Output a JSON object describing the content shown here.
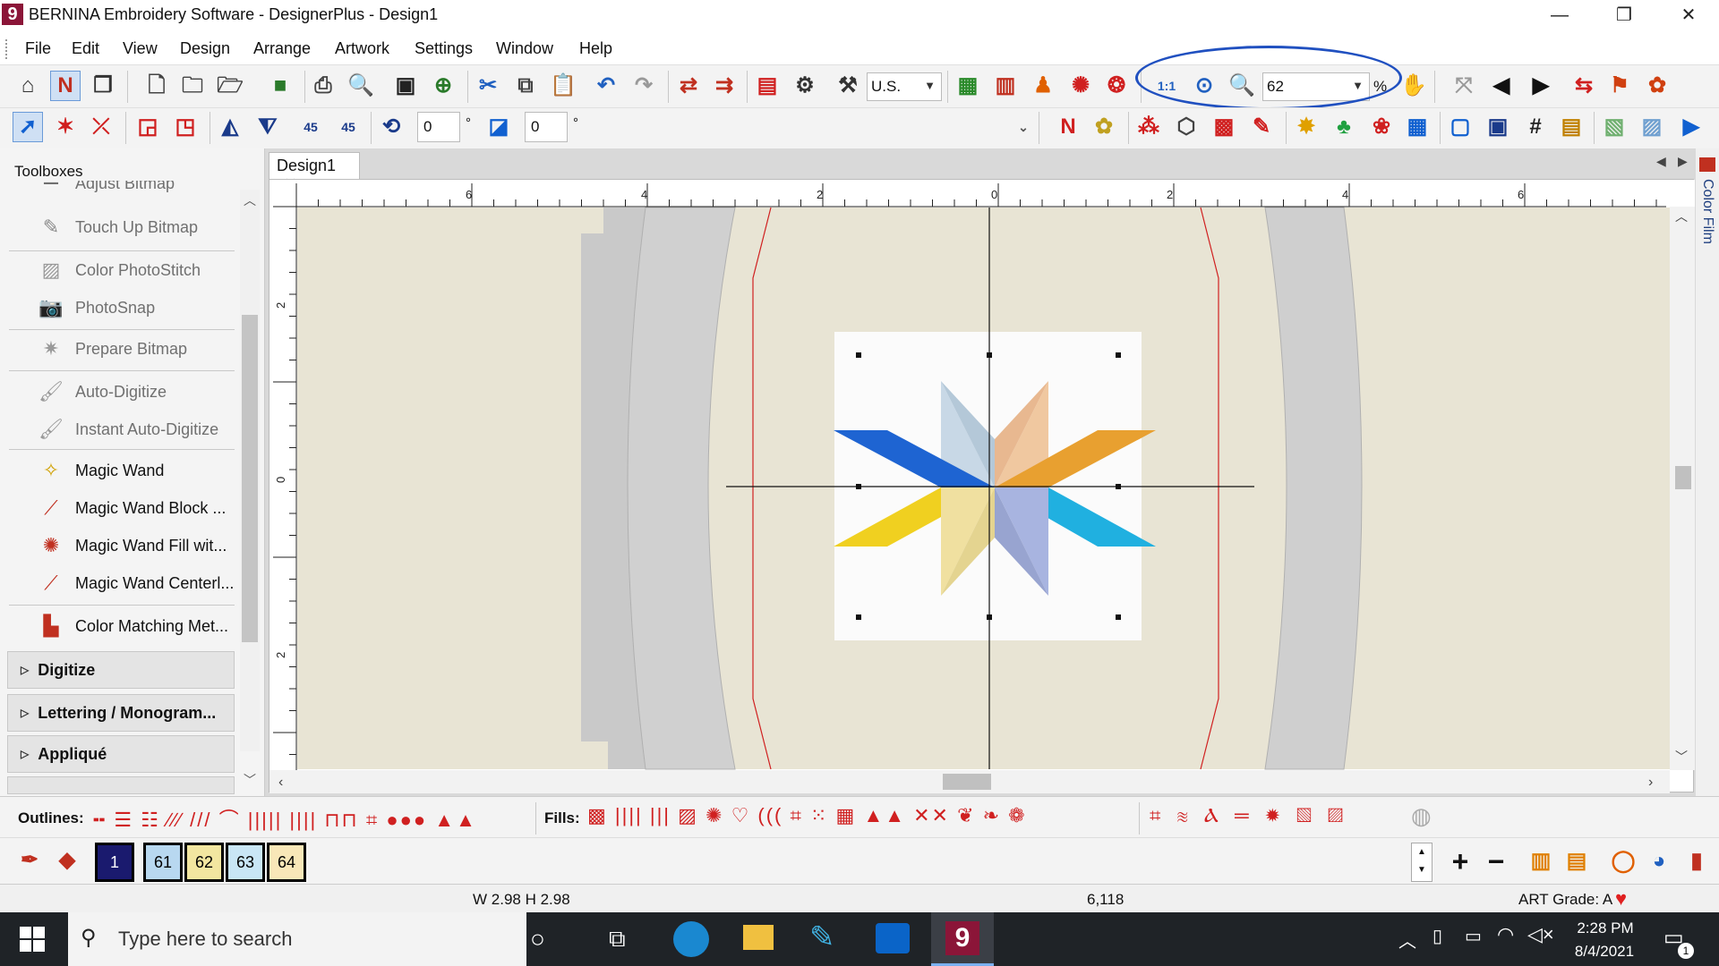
{
  "window": {
    "title": "BERNINA Embroidery Software - DesignerPlus - Design1",
    "logo_glyph": "9",
    "minimize": "—",
    "maximize": "❐",
    "close": "✕"
  },
  "menu": {
    "items": [
      "File",
      "Edit",
      "View",
      "Design",
      "Arrange",
      "Artwork",
      "Settings",
      "Window",
      "Help"
    ]
  },
  "toolbar": {
    "units_value": "U.S.",
    "zoom_value": "62",
    "zoom_unit": "%",
    "zoom_1to1": "1:1",
    "rotate_value": "0",
    "rotate_unit": "°",
    "slant_value": "0",
    "slant_unit": "°",
    "rotate45_label": "45"
  },
  "left_panel": {
    "title": "Toolboxes",
    "partial_item": "Adjust Bitmap",
    "items": [
      {
        "label": "Touch Up Bitmap",
        "icon": "pencil-icon",
        "enabled": false
      },
      {
        "label": "Color PhotoStitch",
        "icon": "photo-icon",
        "enabled": false
      },
      {
        "label": "PhotoSnap",
        "icon": "camera-icon",
        "enabled": false
      },
      {
        "label": "Prepare Bitmap",
        "icon": "sparkle-icon",
        "enabled": false
      },
      {
        "label": "Auto-Digitize",
        "icon": "brush-icon",
        "enabled": false
      },
      {
        "label": "Instant Auto-Digitize",
        "icon": "brush-icon",
        "enabled": false
      },
      {
        "label": "Magic Wand",
        "icon": "magic-wand-icon",
        "enabled": true
      },
      {
        "label": "Magic Wand Block ...",
        "icon": "magic-wand-block-icon",
        "enabled": true
      },
      {
        "label": "Magic Wand Fill wit...",
        "icon": "magic-wand-fill-icon",
        "enabled": true
      },
      {
        "label": "Magic Wand Centerl...",
        "icon": "magic-wand-centerline-icon",
        "enabled": true
      },
      {
        "label": "Color Matching Met...",
        "icon": "color-matching-icon",
        "enabled": true
      }
    ],
    "sections": [
      "Digitize",
      "Lettering / Monogram...",
      "Appliqué"
    ]
  },
  "document": {
    "tab_label": "Design1",
    "tab_close": "✕",
    "ruler_h_labels": [
      "6",
      "4",
      "2",
      "0",
      "2",
      "4",
      "6"
    ],
    "ruler_v_labels": [
      "2",
      "0",
      "2"
    ]
  },
  "color_film": {
    "label": "Color Film"
  },
  "bottom": {
    "outlines_label": "Outlines:",
    "fills_label": "Fills:",
    "color_chips": [
      {
        "label": "1",
        "bg": "#1a1a6e",
        "fg": "#ffffff"
      },
      {
        "label": "61",
        "bg": "#b8d8f0",
        "fg": "#000000"
      },
      {
        "label": "62",
        "bg": "#f2e6a0",
        "fg": "#000000"
      },
      {
        "label": "63",
        "bg": "#c9e6f5",
        "fg": "#000000"
      },
      {
        "label": "64",
        "bg": "#f8e7b8",
        "fg": "#000000"
      }
    ]
  },
  "status": {
    "dimensions": "W 2.98 H 2.98",
    "stitch_count": "6,118",
    "art_grade": "ART Grade: A",
    "heart": "♥"
  },
  "taskbar": {
    "search_placeholder": "Type here to search",
    "time": "2:28 PM",
    "date": "8/4/2021",
    "notification_count": "1",
    "app9_glyph": "9"
  },
  "colors": {
    "star_left_top": "#1e64d2",
    "star_top_left": "#c8d8e6",
    "star_top_right": "#f0c8a0",
    "star_right_top": "#e8a030",
    "star_left_bottom": "#f0d020",
    "star_bottom_left": "#f0e0a0",
    "star_bottom_right": "#a8b4e0",
    "star_right_bottom": "#20b0e0",
    "highlight_oval": "#2050c0"
  }
}
